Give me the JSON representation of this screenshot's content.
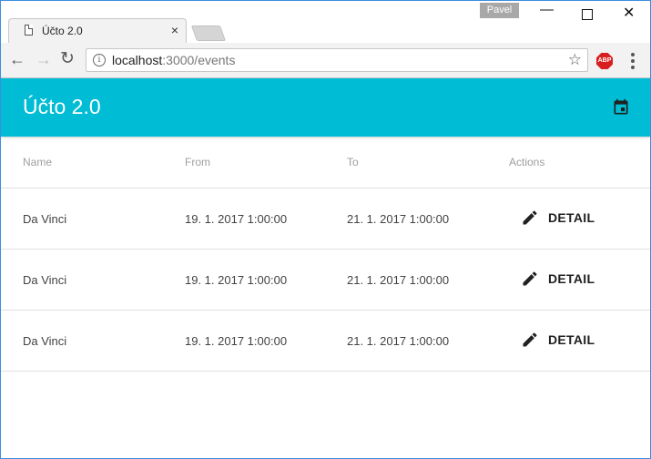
{
  "browser": {
    "tab_title": "Účto 2.0",
    "tab_close": "×",
    "user_badge": "Pavel",
    "window_min": "—",
    "window_close": "✕",
    "url_host": "localhost",
    "url_path": ":3000/events",
    "nav_back": "←",
    "nav_forward": "→",
    "nav_reload": "↻",
    "star": "☆",
    "abp": "ABP",
    "info": "i"
  },
  "app": {
    "title": "Účto 2.0",
    "accent_color": "#00bcd4",
    "action_icon": "calendar-icon"
  },
  "table": {
    "headers": [
      "Name",
      "From",
      "To",
      "Actions"
    ],
    "rows": [
      {
        "name": "Da Vinci",
        "from": "19. 1. 2017 1:00:00",
        "to": "21. 1. 2017 1:00:00",
        "action": "DETAIL",
        "icon": "pencil-icon"
      },
      {
        "name": "Da Vinci",
        "from": "19. 1. 2017 1:00:00",
        "to": "21. 1. 2017 1:00:00",
        "action": "DETAIL",
        "icon": "pencil-icon"
      },
      {
        "name": "Da Vinci",
        "from": "19. 1. 2017 1:00:00",
        "to": "21. 1. 2017 1:00:00",
        "action": "DETAIL",
        "icon": "pencil-icon"
      }
    ]
  }
}
